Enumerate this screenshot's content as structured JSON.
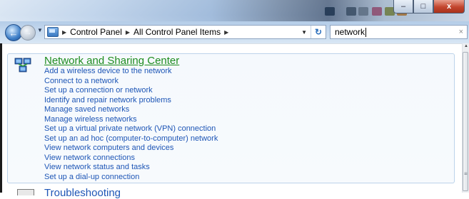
{
  "window": {
    "min_label": "–",
    "max_label": "□",
    "close_label": "x"
  },
  "nav": {
    "back_label": "←",
    "forward_label": "→",
    "history_label": "▼"
  },
  "address": {
    "breadcrumbs": [
      "Control Panel",
      "All Control Panel Items"
    ],
    "separator": "▶",
    "dropdown_label": "▼",
    "refresh_label": "↻"
  },
  "search": {
    "value": "network",
    "clear_label": "×"
  },
  "group": {
    "title": "Network and Sharing Center",
    "title_color": "#1e8c1e",
    "links": [
      "Add a wireless device to the network",
      "Connect to a network",
      "Set up a connection or network",
      "Identify and repair network problems",
      "Manage saved networks",
      "Manage wireless networks",
      "Set up a virtual private network (VPN) connection",
      "Set up an ad hoc (computer-to-computer) network",
      "View network computers and devices",
      "View network connections",
      "View network status and tasks",
      "Set up a dial-up connection"
    ],
    "link_color": "#1e56b6"
  },
  "next_group": {
    "title": "Troubleshooting"
  },
  "scrollbar": {
    "up_label": "▲",
    "grip_label": "≡"
  }
}
